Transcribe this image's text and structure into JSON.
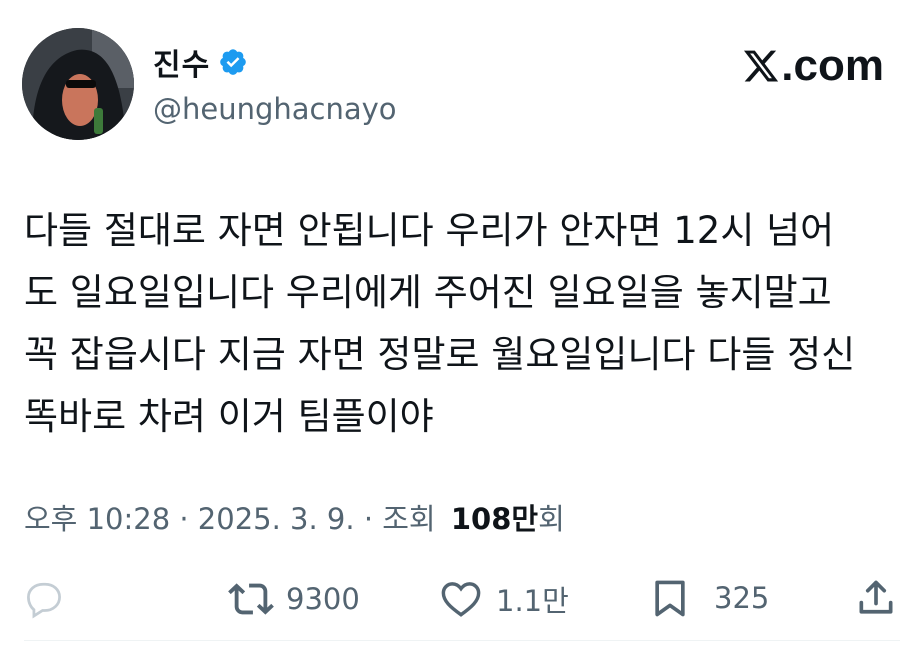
{
  "author": {
    "display_name": "진수",
    "handle": "@heunghacnayo",
    "verified": true,
    "avatar": "avatar-hooded-figure-sunglasses"
  },
  "brand": {
    "text": ".com",
    "icon": "x-logo-icon"
  },
  "tweet": {
    "lines": [
      "다들 절대로 자면 안됩니다 우리가 안자면 12시 넘어",
      "도 일요일입니다 우리에게 주어진 일요일을 놓지말고",
      "꼭 잡읍시다 지금 자면 정말로 월요일입니다 다들 정신",
      "똑바로 차려 이거 팀플이야"
    ]
  },
  "meta": {
    "time_date": "오후 10:28 · 2025. 3. 9. · 조회 ",
    "views_count": "108만",
    "views_suffix": "회"
  },
  "actions": {
    "reply": {
      "icon": "reply-bubble-icon",
      "count": ""
    },
    "retweet": {
      "icon": "retweet-icon",
      "count": "9300"
    },
    "like": {
      "icon": "heart-icon",
      "count": "1.1만"
    },
    "bookmark": {
      "icon": "bookmark-icon",
      "count": "325"
    },
    "share": {
      "icon": "share-icon",
      "count": ""
    }
  },
  "colors": {
    "text": "#0f1419",
    "secondary": "#536471",
    "verified": "#1d9bf0"
  }
}
